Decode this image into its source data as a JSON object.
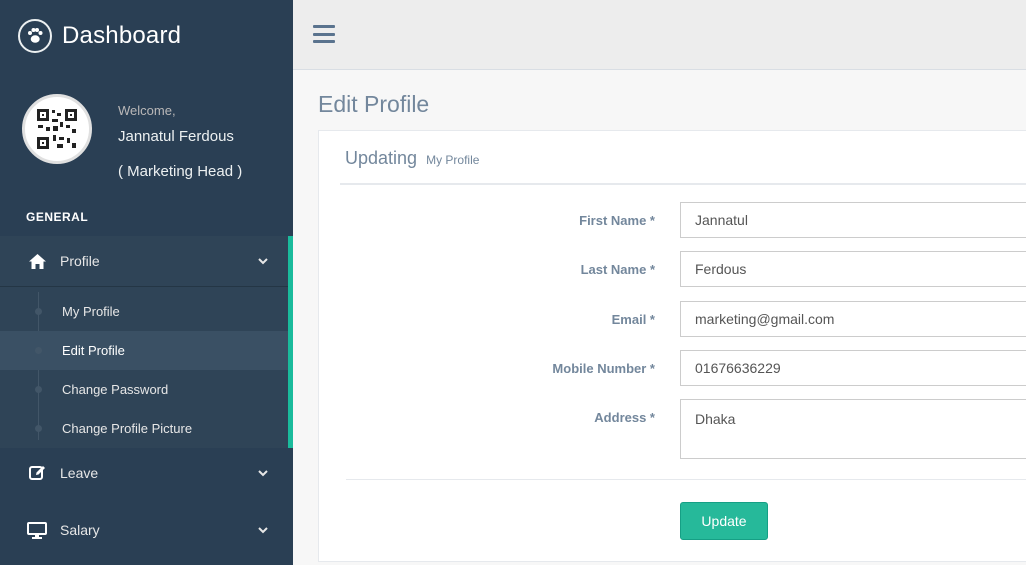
{
  "brand": {
    "title": "Dashboard",
    "icon": "paw-icon"
  },
  "user": {
    "welcome": "Welcome,",
    "name": "Jannatul Ferdous",
    "role": "( Marketing Head )"
  },
  "sidebar": {
    "section_title": "GENERAL",
    "menus": [
      {
        "label": "Profile",
        "icon": "home-icon",
        "expanded": true
      },
      {
        "label": "Leave",
        "icon": "edit-icon",
        "expanded": false
      },
      {
        "label": "Salary",
        "icon": "desktop-icon",
        "expanded": false
      }
    ],
    "profile_sub": [
      {
        "label": "My Profile",
        "active": false
      },
      {
        "label": "Edit Profile",
        "active": true
      },
      {
        "label": "Change Password",
        "active": false
      },
      {
        "label": "Change Profile Picture",
        "active": false
      }
    ]
  },
  "page": {
    "title": "Edit Profile",
    "panel_title": "Updating",
    "panel_subtitle": "My Profile"
  },
  "form": {
    "first_name": {
      "label": "First Name *",
      "value": "Jannatul"
    },
    "last_name": {
      "label": "Last Name *",
      "value": "Ferdous"
    },
    "email": {
      "label": "Email *",
      "value": "marketing@gmail.com"
    },
    "mobile": {
      "label": "Mobile Number *",
      "value": "01676636229"
    },
    "address": {
      "label": "Address *",
      "value": "Dhaka"
    },
    "submit_label": "Update"
  },
  "colors": {
    "sidebar_bg": "#2a3f54",
    "accent": "#1abb9c",
    "button": "#26b99a",
    "text_muted": "#73879c"
  }
}
